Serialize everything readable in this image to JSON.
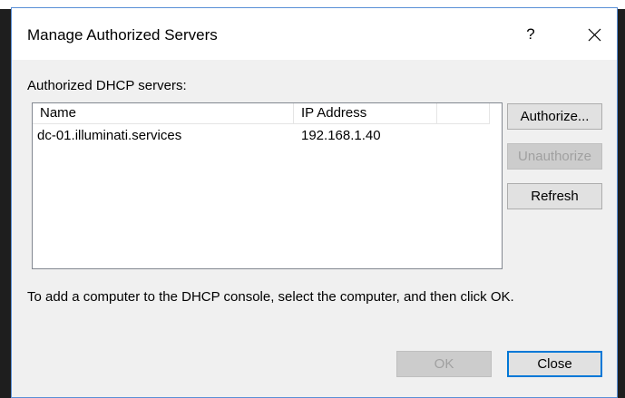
{
  "dialog": {
    "title": "Manage Authorized Servers",
    "help_label": "?",
    "list_caption": "Authorized DHCP servers:",
    "columns": {
      "name": "Name",
      "ip": "IP Address"
    },
    "rows": [
      {
        "name": "dc-01.illuminati.services",
        "ip": "192.168.1.40"
      }
    ],
    "buttons": {
      "authorize": "Authorize...",
      "unauthorize": "Unauthorize",
      "refresh": "Refresh",
      "ok": "OK",
      "close": "Close"
    },
    "hint": "To add a computer to the DHCP console, select the computer, and then click OK."
  }
}
